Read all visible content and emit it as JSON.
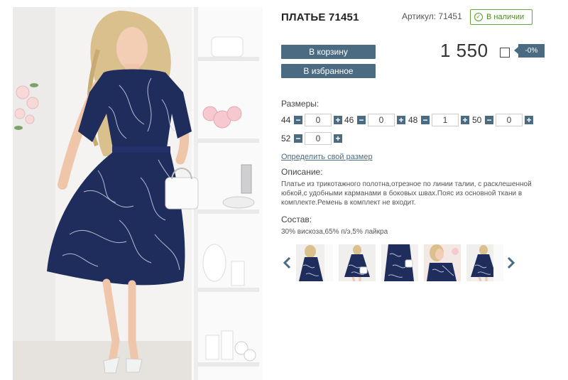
{
  "product": {
    "title": "ПЛАТЬЕ 71451",
    "sku_label": "Артикул: 71451",
    "stock_label": "В наличии",
    "price": "1 550",
    "discount": "-0%"
  },
  "actions": {
    "cart_label": "В корзину",
    "favorites_label": "В избранное"
  },
  "sizes": {
    "label": "Размеры:",
    "items": [
      {
        "size": "44",
        "qty": "0"
      },
      {
        "size": "46",
        "qty": "0"
      },
      {
        "size": "48",
        "qty": "1"
      },
      {
        "size": "50",
        "qty": "0"
      },
      {
        "size": "52",
        "qty": "0"
      }
    ],
    "find_size_link": "Определить свой размер"
  },
  "description": {
    "label": "Описание:",
    "text": "Платье из трикотажного полотна,отрезное по линии талии, с расклешенной юбкой,с удобными карманами в боковых швах.Пояс из основной ткани в комплекте.Ремень в комплект не входит."
  },
  "composition": {
    "label": "Состав:",
    "text": "30% вискоза,65% п/э,5% лайкра"
  },
  "gallery": {
    "thumbnail_count": 5
  },
  "colors": {
    "accent": "#4a6b82",
    "stock_green": "#4d8a23",
    "dress_navy": "#1f2d5c"
  },
  "icons": {
    "stock": "check-circle-icon",
    "prev": "chevron-left-icon",
    "next": "chevron-right-icon"
  }
}
